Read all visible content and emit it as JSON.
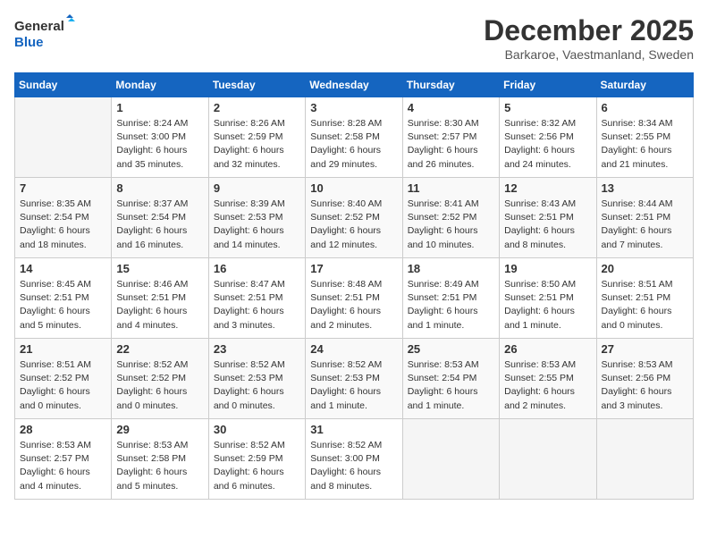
{
  "header": {
    "logo_line1": "General",
    "logo_line2": "Blue",
    "month": "December 2025",
    "location": "Barkaroe, Vaestmanland, Sweden"
  },
  "days_of_week": [
    "Sunday",
    "Monday",
    "Tuesday",
    "Wednesday",
    "Thursday",
    "Friday",
    "Saturday"
  ],
  "weeks": [
    [
      {
        "day": "",
        "info": ""
      },
      {
        "day": "1",
        "info": "Sunrise: 8:24 AM\nSunset: 3:00 PM\nDaylight: 6 hours\nand 35 minutes."
      },
      {
        "day": "2",
        "info": "Sunrise: 8:26 AM\nSunset: 2:59 PM\nDaylight: 6 hours\nand 32 minutes."
      },
      {
        "day": "3",
        "info": "Sunrise: 8:28 AM\nSunset: 2:58 PM\nDaylight: 6 hours\nand 29 minutes."
      },
      {
        "day": "4",
        "info": "Sunrise: 8:30 AM\nSunset: 2:57 PM\nDaylight: 6 hours\nand 26 minutes."
      },
      {
        "day": "5",
        "info": "Sunrise: 8:32 AM\nSunset: 2:56 PM\nDaylight: 6 hours\nand 24 minutes."
      },
      {
        "day": "6",
        "info": "Sunrise: 8:34 AM\nSunset: 2:55 PM\nDaylight: 6 hours\nand 21 minutes."
      }
    ],
    [
      {
        "day": "7",
        "info": "Sunrise: 8:35 AM\nSunset: 2:54 PM\nDaylight: 6 hours\nand 18 minutes."
      },
      {
        "day": "8",
        "info": "Sunrise: 8:37 AM\nSunset: 2:54 PM\nDaylight: 6 hours\nand 16 minutes."
      },
      {
        "day": "9",
        "info": "Sunrise: 8:39 AM\nSunset: 2:53 PM\nDaylight: 6 hours\nand 14 minutes."
      },
      {
        "day": "10",
        "info": "Sunrise: 8:40 AM\nSunset: 2:52 PM\nDaylight: 6 hours\nand 12 minutes."
      },
      {
        "day": "11",
        "info": "Sunrise: 8:41 AM\nSunset: 2:52 PM\nDaylight: 6 hours\nand 10 minutes."
      },
      {
        "day": "12",
        "info": "Sunrise: 8:43 AM\nSunset: 2:51 PM\nDaylight: 6 hours\nand 8 minutes."
      },
      {
        "day": "13",
        "info": "Sunrise: 8:44 AM\nSunset: 2:51 PM\nDaylight: 6 hours\nand 7 minutes."
      }
    ],
    [
      {
        "day": "14",
        "info": "Sunrise: 8:45 AM\nSunset: 2:51 PM\nDaylight: 6 hours\nand 5 minutes."
      },
      {
        "day": "15",
        "info": "Sunrise: 8:46 AM\nSunset: 2:51 PM\nDaylight: 6 hours\nand 4 minutes."
      },
      {
        "day": "16",
        "info": "Sunrise: 8:47 AM\nSunset: 2:51 PM\nDaylight: 6 hours\nand 3 minutes."
      },
      {
        "day": "17",
        "info": "Sunrise: 8:48 AM\nSunset: 2:51 PM\nDaylight: 6 hours\nand 2 minutes."
      },
      {
        "day": "18",
        "info": "Sunrise: 8:49 AM\nSunset: 2:51 PM\nDaylight: 6 hours\nand 1 minute."
      },
      {
        "day": "19",
        "info": "Sunrise: 8:50 AM\nSunset: 2:51 PM\nDaylight: 6 hours\nand 1 minute."
      },
      {
        "day": "20",
        "info": "Sunrise: 8:51 AM\nSunset: 2:51 PM\nDaylight: 6 hours\nand 0 minutes."
      }
    ],
    [
      {
        "day": "21",
        "info": "Sunrise: 8:51 AM\nSunset: 2:52 PM\nDaylight: 6 hours\nand 0 minutes."
      },
      {
        "day": "22",
        "info": "Sunrise: 8:52 AM\nSunset: 2:52 PM\nDaylight: 6 hours\nand 0 minutes."
      },
      {
        "day": "23",
        "info": "Sunrise: 8:52 AM\nSunset: 2:53 PM\nDaylight: 6 hours\nand 0 minutes."
      },
      {
        "day": "24",
        "info": "Sunrise: 8:52 AM\nSunset: 2:53 PM\nDaylight: 6 hours\nand 1 minute."
      },
      {
        "day": "25",
        "info": "Sunrise: 8:53 AM\nSunset: 2:54 PM\nDaylight: 6 hours\nand 1 minute."
      },
      {
        "day": "26",
        "info": "Sunrise: 8:53 AM\nSunset: 2:55 PM\nDaylight: 6 hours\nand 2 minutes."
      },
      {
        "day": "27",
        "info": "Sunrise: 8:53 AM\nSunset: 2:56 PM\nDaylight: 6 hours\nand 3 minutes."
      }
    ],
    [
      {
        "day": "28",
        "info": "Sunrise: 8:53 AM\nSunset: 2:57 PM\nDaylight: 6 hours\nand 4 minutes."
      },
      {
        "day": "29",
        "info": "Sunrise: 8:53 AM\nSunset: 2:58 PM\nDaylight: 6 hours\nand 5 minutes."
      },
      {
        "day": "30",
        "info": "Sunrise: 8:52 AM\nSunset: 2:59 PM\nDaylight: 6 hours\nand 6 minutes."
      },
      {
        "day": "31",
        "info": "Sunrise: 8:52 AM\nSunset: 3:00 PM\nDaylight: 6 hours\nand 8 minutes."
      },
      {
        "day": "",
        "info": ""
      },
      {
        "day": "",
        "info": ""
      },
      {
        "day": "",
        "info": ""
      }
    ]
  ]
}
